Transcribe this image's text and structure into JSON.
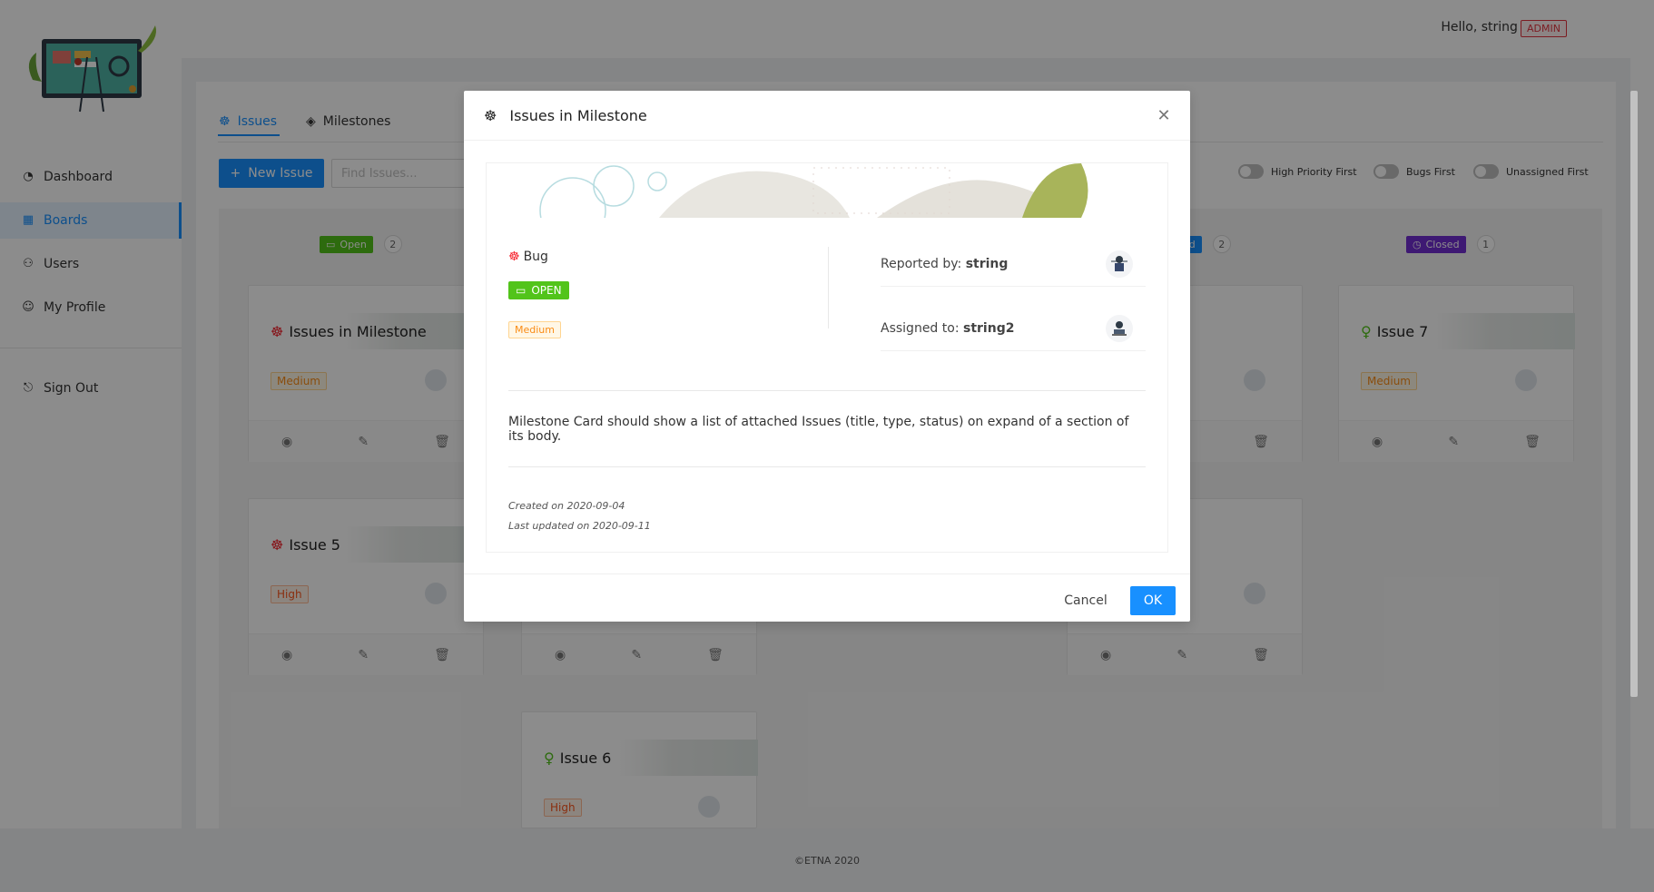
{
  "header": {
    "greeting": "Hello,  string  !",
    "role_badge": "ADMIN"
  },
  "sidebar": {
    "items": [
      {
        "label": "Dashboard",
        "icon": "dashboard-icon"
      },
      {
        "label": "Boards",
        "icon": "grid-icon",
        "active": true
      },
      {
        "label": "Users",
        "icon": "users-icon"
      },
      {
        "label": "My Profile",
        "icon": "user-icon"
      },
      {
        "label": "Sign Out",
        "icon": "logout-icon"
      }
    ]
  },
  "tabs": [
    {
      "label": "Issues"
    },
    {
      "label": "Milestones"
    }
  ],
  "toolbar": {
    "new_issue_label": "New Issue",
    "search_placeholder": "Find Issues...",
    "toggles": [
      {
        "label": "High Priority First"
      },
      {
        "label": "Bugs First"
      },
      {
        "label": "Unassigned First"
      }
    ]
  },
  "columns": [
    {
      "label": "Open",
      "count": "2",
      "color": "#52c41a"
    },
    {
      "label": "ed",
      "count": "2",
      "color": "#1890ff"
    },
    {
      "label": "Closed",
      "count": "1",
      "color": "#722ed1"
    }
  ],
  "cards": [
    {
      "title": "Issues in Milestone",
      "priority": "Medium",
      "type": "bug"
    },
    {
      "title": "Issue 5",
      "priority": "High",
      "type": "bug"
    },
    {
      "title": "Issue 6",
      "priority": "High",
      "type": "idea"
    },
    {
      "title": "Issue 7",
      "priority": "Medium",
      "type": "idea"
    }
  ],
  "modal": {
    "title": "Issues in Milestone",
    "type_label": "Bug",
    "status_label": "OPEN",
    "priority_label": "Medium",
    "reported_prefix": "Reported by: ",
    "reported_by": "string",
    "assigned_prefix": "Assigned to: ",
    "assigned_to": "string2",
    "description": "Milestone Card should show a list of attached Issues (title, type, status) on expand of a section of its body.",
    "created": "Created on 2020-09-04",
    "updated": "Last updated on 2020-09-11",
    "cancel_label": "Cancel",
    "ok_label": "OK"
  },
  "footer": {
    "text": "©ETNA 2020"
  },
  "colors": {
    "accent": "#1890ff",
    "open": "#52c41a",
    "closed": "#722ed1",
    "bug": "#f5222d",
    "idea": "#52c41a"
  }
}
